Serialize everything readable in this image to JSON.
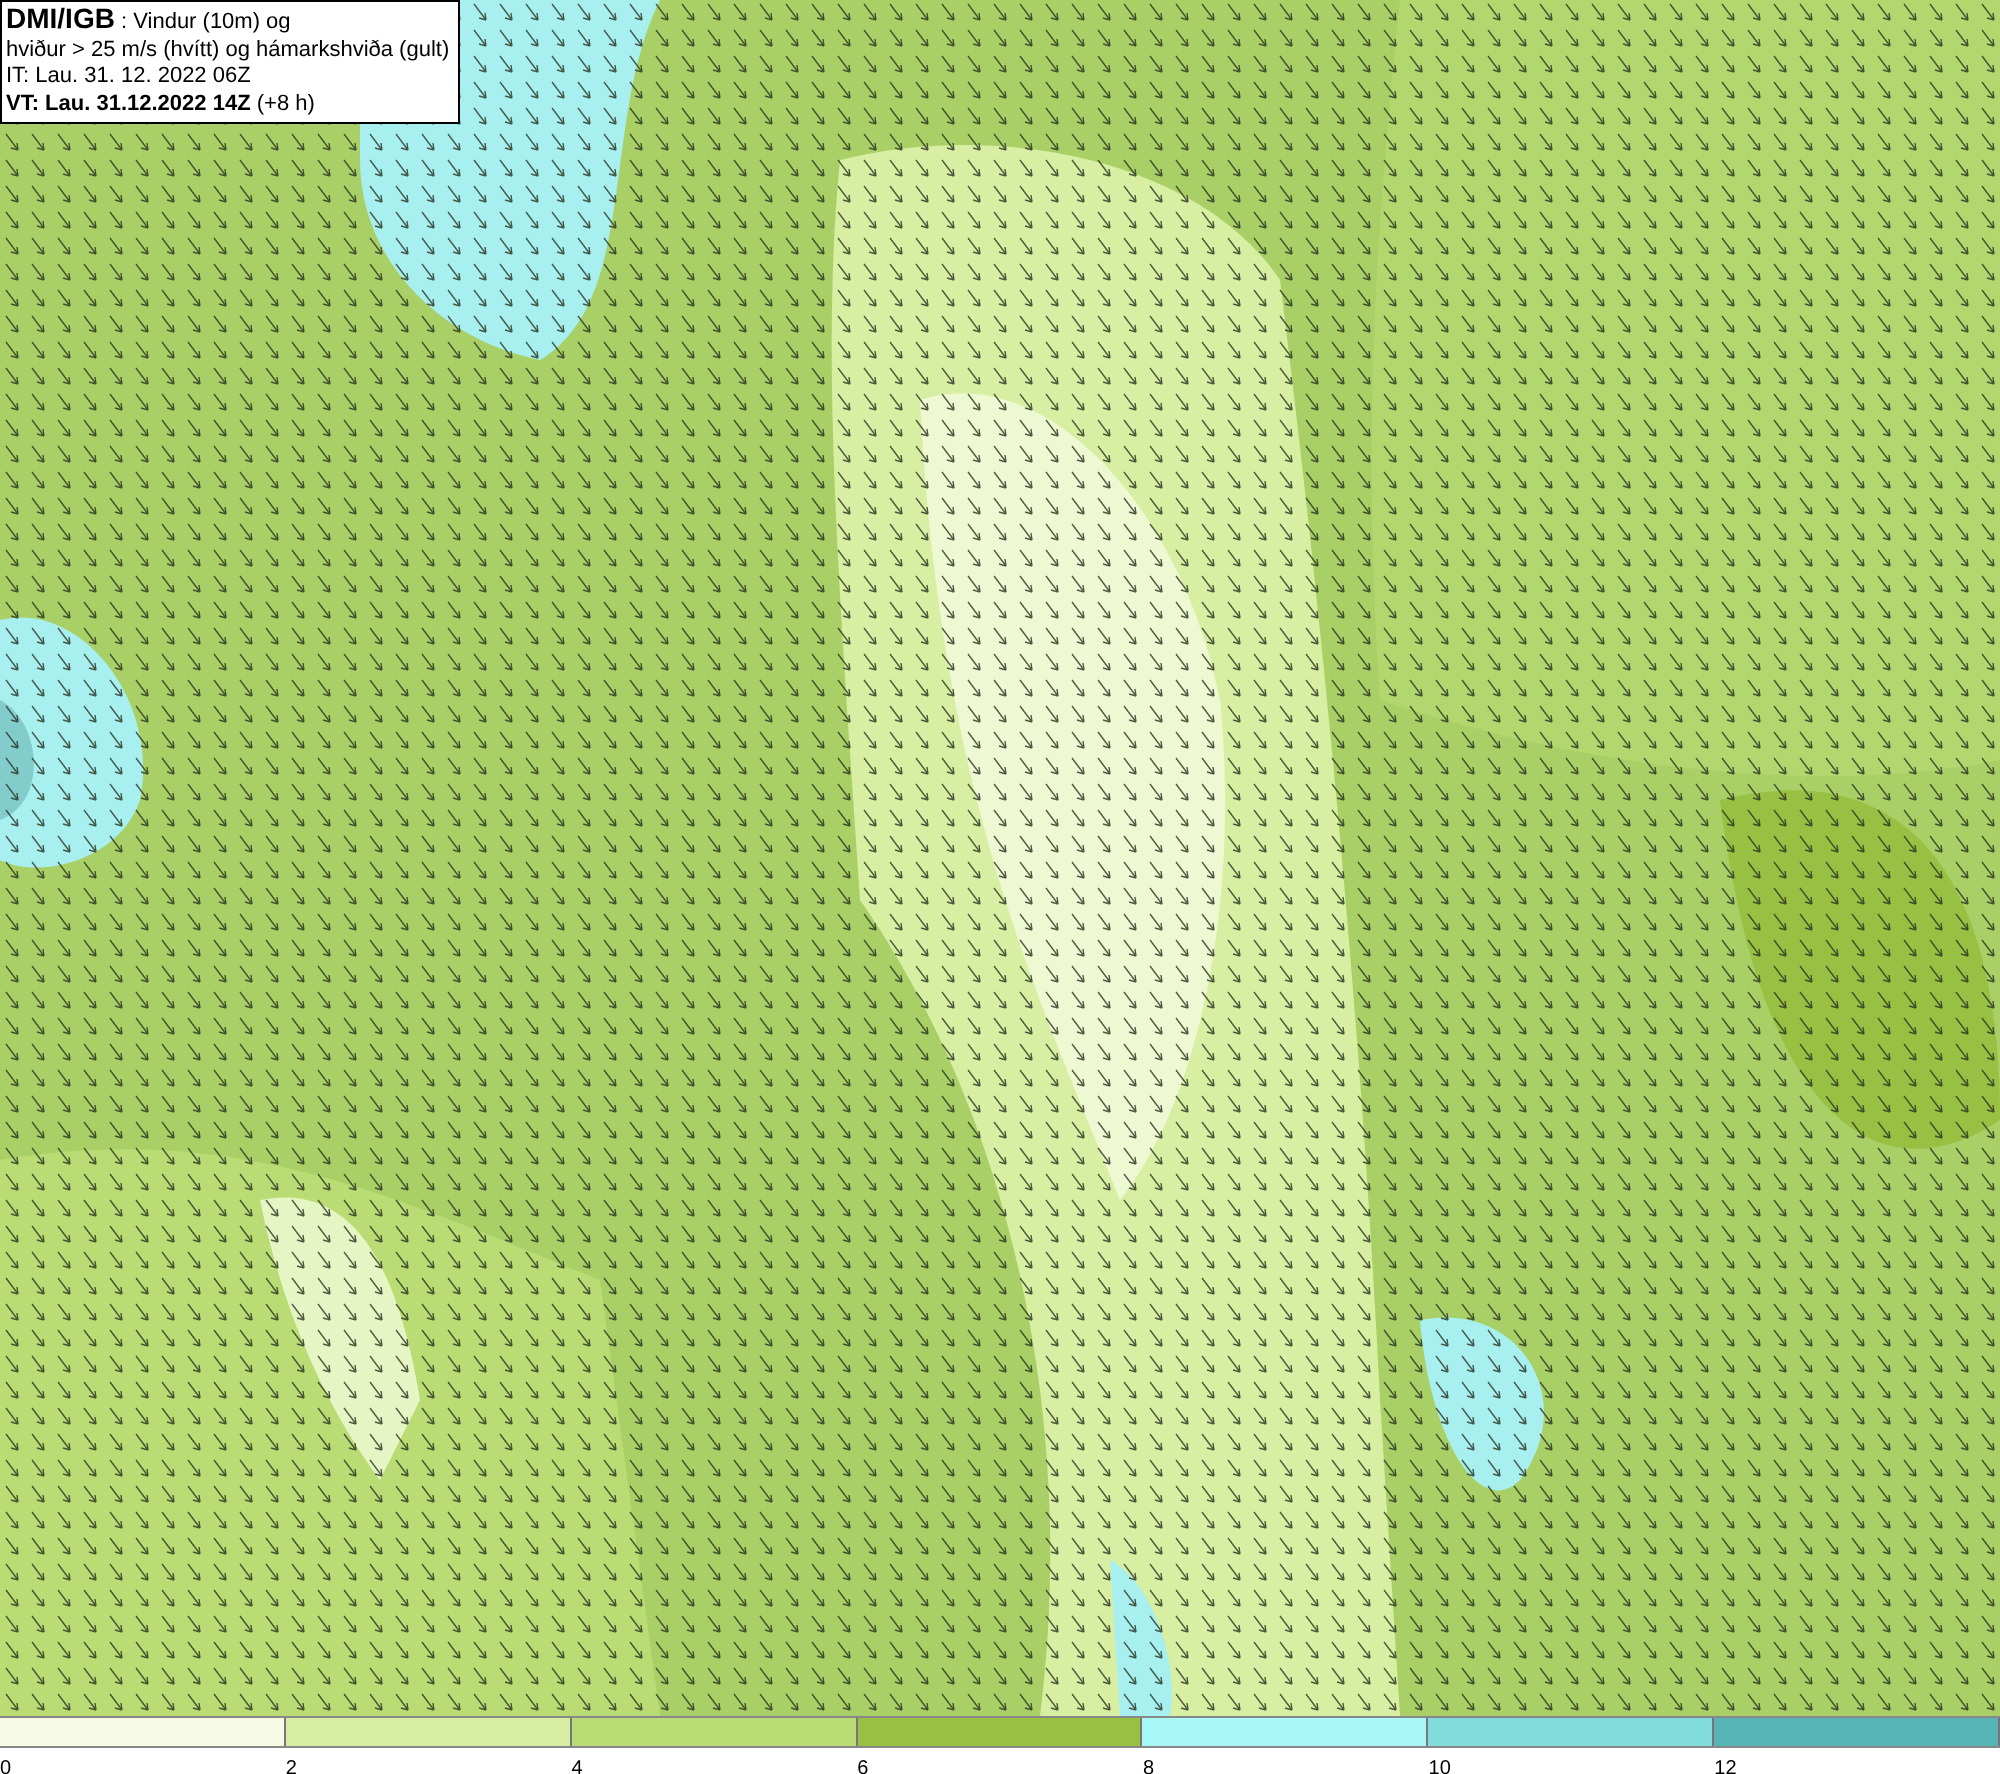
{
  "title_box": {
    "lines": [
      "**DMI/IGB** : Vindur (10m) og",
      "hviður > 25 m/s (hvítt) og hámarkshviða (gult)",
      "IT: Lau. 31. 12. 2022 06Z",
      "**VT: Lau. 31.12.2022 14Z** (+8 h)"
    ]
  },
  "legend": {
    "segments": [
      {
        "color": "#f7fbe6"
      },
      {
        "color": "#d8efa3"
      },
      {
        "color": "#b9dc75"
      },
      {
        "color": "#98c143"
      },
      {
        "color": "#a8f8f8"
      },
      {
        "color": "#82dcdc"
      },
      {
        "color": "#56b4b4"
      }
    ],
    "ticks": [
      "0",
      "2",
      "4",
      "6",
      "8",
      "10",
      "12"
    ]
  }
}
